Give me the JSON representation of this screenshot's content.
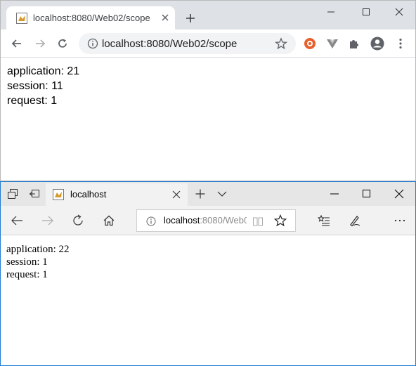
{
  "chrome": {
    "tab_title": "localhost:8080/Web02/scope",
    "url": "localhost:8080/Web02/scope",
    "content": {
      "application": "application: 21",
      "session": "session: 11",
      "request": "request: 1"
    }
  },
  "edge": {
    "tab_title": "localhost",
    "url_host": "localhost",
    "url_rest": ":8080/Web0",
    "content": {
      "application": "application: 22",
      "session": "session: 1",
      "request": "request: 1"
    }
  },
  "colors": {
    "chrome_tabbar": "#dee1e6",
    "edge_border": "#1e7bd3",
    "extension_orange": "#e8602c"
  }
}
